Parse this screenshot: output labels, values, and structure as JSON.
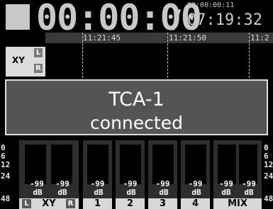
{
  "header": {
    "main_counter": "00:00:00",
    "slash": "/",
    "sub_counter": "00:00:00:11",
    "total_time": "07:19:32"
  },
  "timeline": {
    "ticks": [
      "11:21:45",
      "11:21:50",
      "11:2"
    ]
  },
  "track": {
    "name": "XY",
    "left_label": "L",
    "right_label": "R"
  },
  "popup": {
    "title": "TCA-1",
    "status": "connected"
  },
  "meters": {
    "scale": [
      "0",
      "6",
      "12",
      "24",
      "48"
    ],
    "channels": [
      {
        "name": "XY",
        "left_label": "L",
        "right_label": "R",
        "values": [
          "-99",
          "-99"
        ],
        "units": [
          "dB",
          "dB"
        ]
      },
      {
        "name": "1",
        "values": [
          "-99"
        ],
        "units": [
          "dB"
        ]
      },
      {
        "name": "2",
        "values": [
          "-99"
        ],
        "units": [
          "dB"
        ]
      },
      {
        "name": "3",
        "values": [
          "-99"
        ],
        "units": [
          "dB"
        ]
      },
      {
        "name": "4",
        "values": [
          "-99"
        ],
        "units": [
          "dB"
        ]
      },
      {
        "name": "MIX",
        "values": [
          "-99",
          "-99"
        ],
        "units": [
          "dB",
          "dB"
        ]
      }
    ]
  }
}
